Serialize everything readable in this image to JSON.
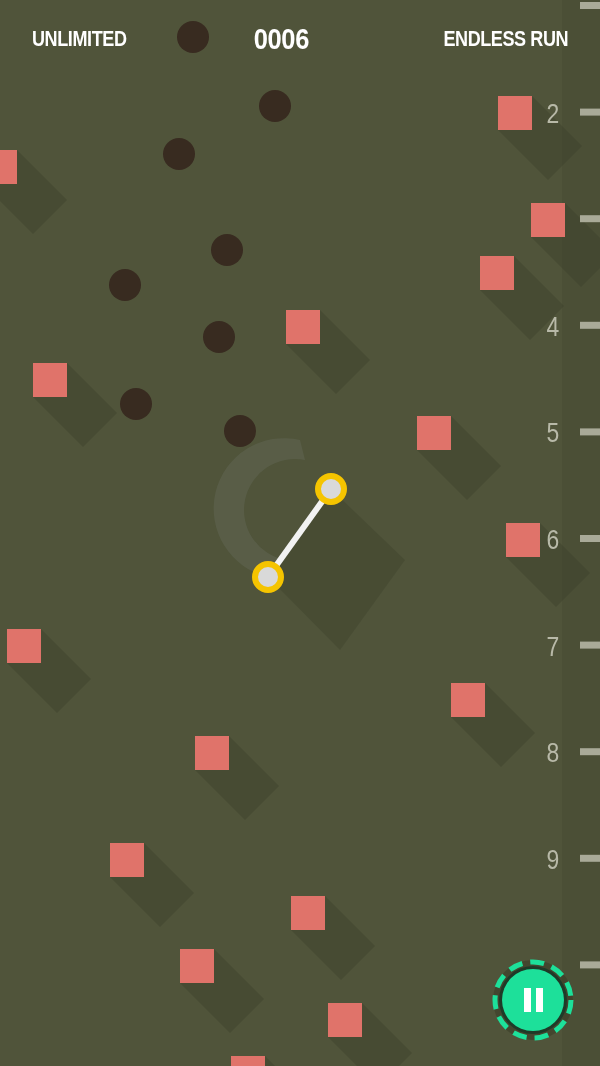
{
  "hud": {
    "mode": "UNLIMITED",
    "score": "0006",
    "run_type": "ENDLESS RUN"
  },
  "ruler": [
    {
      "kind": "plain"
    },
    {
      "kind": "labeled",
      "label": "2"
    },
    {
      "kind": "plain"
    },
    {
      "kind": "labeled",
      "label": "4"
    },
    {
      "kind": "labeled",
      "label": "5"
    },
    {
      "kind": "labeled",
      "label": "6"
    },
    {
      "kind": "labeled",
      "label": "7"
    },
    {
      "kind": "labeled",
      "label": "8"
    },
    {
      "kind": "labeled",
      "label": "9"
    },
    {
      "kind": "plain"
    }
  ]
}
